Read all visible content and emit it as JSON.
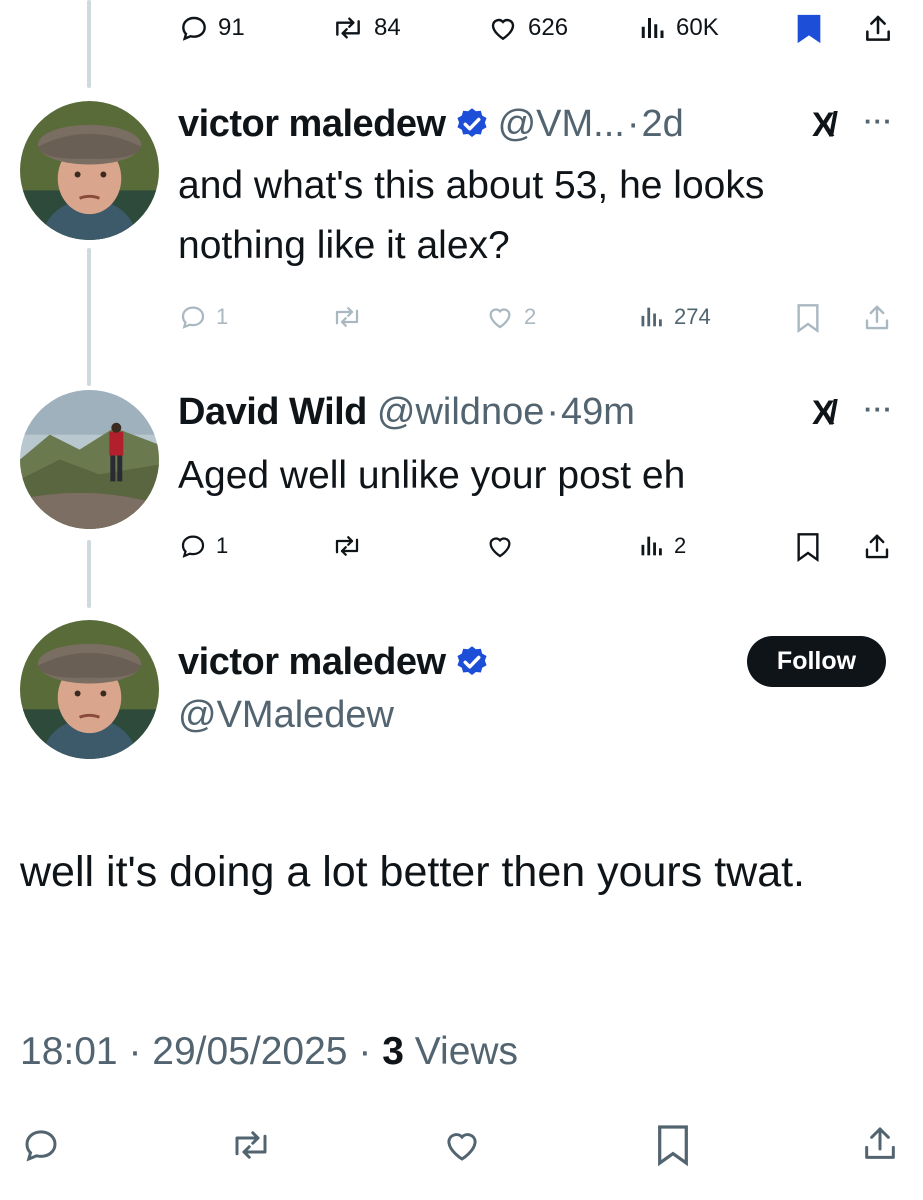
{
  "top_actions": {
    "replies": "91",
    "reposts": "84",
    "likes": "626",
    "views": "60K"
  },
  "reply1": {
    "name": "victor maledew",
    "handle": "@VM...",
    "separator": "·",
    "time": "2d",
    "text": "and what's this about 53, he looks nothing like it alex?",
    "replies": "1",
    "reposts": "",
    "likes": "2",
    "views": "274"
  },
  "reply2": {
    "name": "David Wild",
    "handle": "@wildnoe",
    "separator": "·",
    "time": "49m",
    "text": "Aged well unlike your post eh",
    "replies": "1",
    "reposts": "",
    "likes": "",
    "views": "2"
  },
  "main": {
    "name": "victor maledew",
    "handle": "@VMaledew",
    "follow_label": "Follow",
    "text": "well it's doing a lot better then yours twat.",
    "time": "18:01",
    "dot": "·",
    "date": "29/05/2025",
    "views_count": "3",
    "views_label": "Views"
  },
  "icons": {
    "reply": "reply-icon",
    "repost": "repost-icon",
    "like": "heart-icon",
    "views": "views-icon",
    "bookmark": "bookmark-icon",
    "share": "share-icon",
    "verified": "verified-badge-icon",
    "grok": "grok-icon",
    "more": "more-icon"
  },
  "more_glyph": "···",
  "grok_glyph": "X/",
  "colors": {
    "verified": "#1d4ed8",
    "bookmark_active": "#1d4ed8",
    "text": "#0f1419",
    "muted": "#536471",
    "line": "#cfd9de"
  }
}
